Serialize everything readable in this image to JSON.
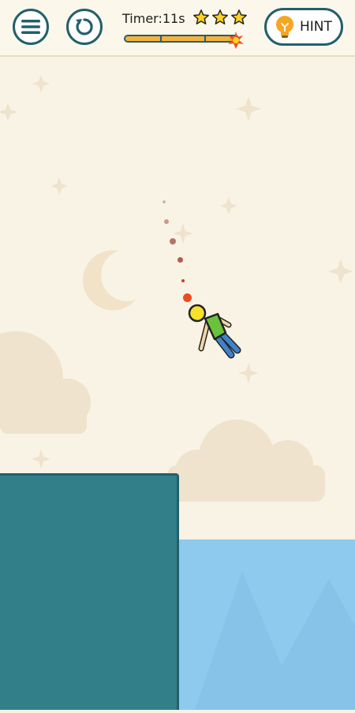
{
  "header": {
    "timer_text": "Timer:11s",
    "stars_count": 3,
    "progress_fraction": 0.93,
    "hint_label": "HINT"
  },
  "icons": {
    "menu": "hamburger-menu-icon",
    "restart": "restart-icon",
    "star": "star-icon",
    "hint": "lightbulb-icon",
    "spark": "burning-fuse-icon"
  },
  "colors": {
    "sky": "#f8f3e5",
    "cliff": "#337f89",
    "outline": "#21606c",
    "water": "#8ecaee",
    "star": "#ffd21f",
    "progress": "#f5a623"
  }
}
